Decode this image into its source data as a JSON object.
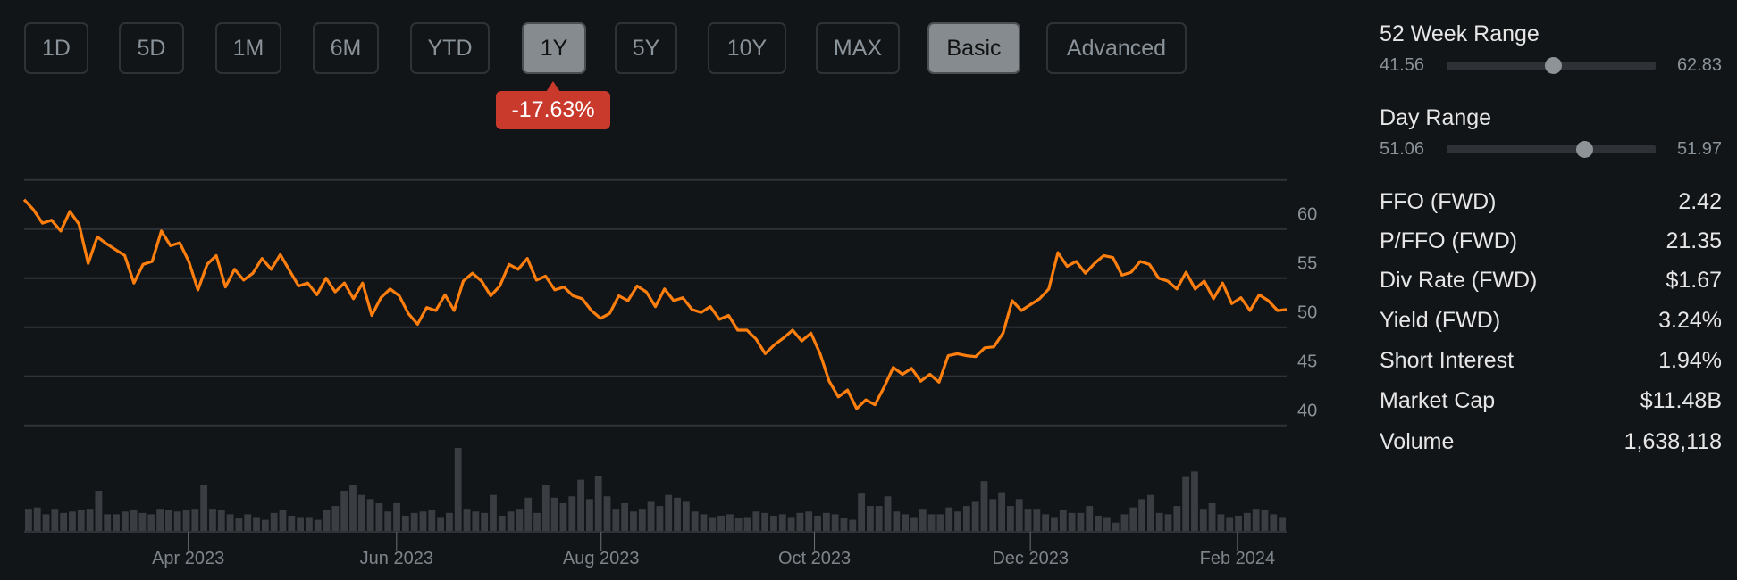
{
  "toolbar": {
    "periods": [
      "1D",
      "5D",
      "1M",
      "6M",
      "YTD",
      "1Y",
      "5Y",
      "10Y",
      "MAX"
    ],
    "active_period": "1Y",
    "modes": [
      "Basic",
      "Advanced"
    ],
    "active_mode": "Basic",
    "change_badge": "-17.63%",
    "badge_color": "#c93a2c"
  },
  "ranges": {
    "week52": {
      "title": "52 Week Range",
      "low": "41.56",
      "high": "62.83",
      "position": 0.51
    },
    "day": {
      "title": "Day Range",
      "low": "51.06",
      "high": "51.97",
      "position": 0.66
    }
  },
  "stats": [
    {
      "label": "FFO (FWD)",
      "value": "2.42"
    },
    {
      "label": "P/FFO (FWD)",
      "value": "21.35"
    },
    {
      "label": "Div Rate (FWD)",
      "value": "$1.67"
    },
    {
      "label": "Yield (FWD)",
      "value": "3.24%"
    },
    {
      "label": "Short Interest",
      "value": "1.94%"
    },
    {
      "label": "Market Cap",
      "value": "$11.48B"
    },
    {
      "label": "Volume",
      "value": "1,638,118"
    }
  ],
  "chart_data": {
    "type": "line",
    "line_color": "#ff7f0e",
    "volume_color": "#3a3e42",
    "ylim": [
      40,
      65
    ],
    "yticks": [
      "60",
      "55",
      "50",
      "45",
      "40"
    ],
    "ytick_values": [
      60,
      55,
      50,
      45,
      40
    ],
    "xticks": [
      "Apr 2023",
      "Jun 2023",
      "Aug 2023",
      "Oct 2023",
      "Dec 2023",
      "Feb 2024"
    ],
    "xtick_positions": [
      0.13,
      0.295,
      0.457,
      0.626,
      0.797,
      0.961
    ],
    "values": [
      63.0,
      62.0,
      60.6,
      60.9,
      59.8,
      61.8,
      60.5,
      56.5,
      59.2,
      58.5,
      57.9,
      57.3,
      54.5,
      56.4,
      56.7,
      59.8,
      58.3,
      58.6,
      56.7,
      53.8,
      56.4,
      57.3,
      54.1,
      55.9,
      54.8,
      55.5,
      57.0,
      55.9,
      57.4,
      55.8,
      54.2,
      54.5,
      53.3,
      55.0,
      53.6,
      54.5,
      52.9,
      54.5,
      51.2,
      53.0,
      53.9,
      53.2,
      51.4,
      50.3,
      52.0,
      51.7,
      53.3,
      51.7,
      54.7,
      55.5,
      54.7,
      53.2,
      54.2,
      56.4,
      55.9,
      57.0,
      54.8,
      55.2,
      53.8,
      54.1,
      53.2,
      52.9,
      51.7,
      50.9,
      51.4,
      53.2,
      52.7,
      54.2,
      53.6,
      52.1,
      53.9,
      52.7,
      53.0,
      51.8,
      51.5,
      52.1,
      50.8,
      51.2,
      49.7,
      49.7,
      48.8,
      47.3,
      48.2,
      48.9,
      49.7,
      48.6,
      49.4,
      47.3,
      44.5,
      42.9,
      43.6,
      41.7,
      42.6,
      42.1,
      43.9,
      45.9,
      45.2,
      45.8,
      44.5,
      45.2,
      44.4,
      47.1,
      47.3,
      47.1,
      47.0,
      47.9,
      48.0,
      49.4,
      52.7,
      51.7,
      52.3,
      52.9,
      53.9,
      57.6,
      56.2,
      56.7,
      55.5,
      56.5,
      57.3,
      57.1,
      55.3,
      55.6,
      56.7,
      56.4,
      55.0,
      54.7,
      53.9,
      55.6,
      53.9,
      54.7,
      52.9,
      54.5,
      52.4,
      53.0,
      51.7,
      53.3,
      52.7,
      51.7,
      51.8
    ],
    "volume": [
      1.6,
      1.7,
      1.2,
      1.6,
      1.3,
      1.4,
      1.5,
      1.6,
      2.9,
      1.2,
      1.2,
      1.4,
      1.5,
      1.3,
      1.2,
      1.6,
      1.5,
      1.4,
      1.5,
      1.6,
      3.3,
      1.6,
      1.5,
      1.2,
      0.9,
      1.2,
      1.0,
      0.8,
      1.3,
      1.5,
      1.1,
      1.0,
      1.0,
      0.8,
      1.5,
      1.8,
      2.9,
      3.3,
      2.6,
      2.3,
      2.0,
      1.4,
      2.0,
      1.1,
      1.3,
      1.4,
      1.5,
      1.0,
      1.3,
      6.0,
      1.6,
      1.4,
      1.3,
      2.6,
      1.1,
      1.4,
      1.6,
      2.4,
      1.3,
      3.3,
      2.4,
      2.0,
      2.5,
      3.7,
      2.3,
      4.0,
      2.5,
      1.6,
      2.0,
      1.4,
      1.6,
      2.1,
      1.8,
      2.6,
      2.4,
      2.1,
      1.4,
      1.2,
      1.0,
      1.1,
      1.2,
      0.9,
      1.0,
      1.4,
      1.3,
      1.1,
      1.2,
      1.0,
      1.3,
      1.4,
      1.1,
      1.3,
      1.2,
      0.9,
      0.8,
      2.7,
      1.8,
      1.8,
      2.5,
      1.4,
      1.2,
      1.0,
      1.6,
      1.2,
      1.2,
      1.7,
      1.4,
      1.8,
      2.1,
      3.6,
      2.3,
      2.8,
      1.8,
      2.3,
      1.6,
      1.6,
      1.2,
      1.0,
      1.5,
      1.3,
      1.3,
      1.8,
      1.1,
      1.0,
      0.6,
      1.2,
      1.7,
      2.3,
      2.6,
      1.3,
      1.2,
      1.8,
      3.9,
      4.3,
      1.6,
      2.0,
      1.2,
      1.0,
      1.1,
      1.3,
      1.6,
      1.5,
      1.2,
      1.0
    ]
  }
}
